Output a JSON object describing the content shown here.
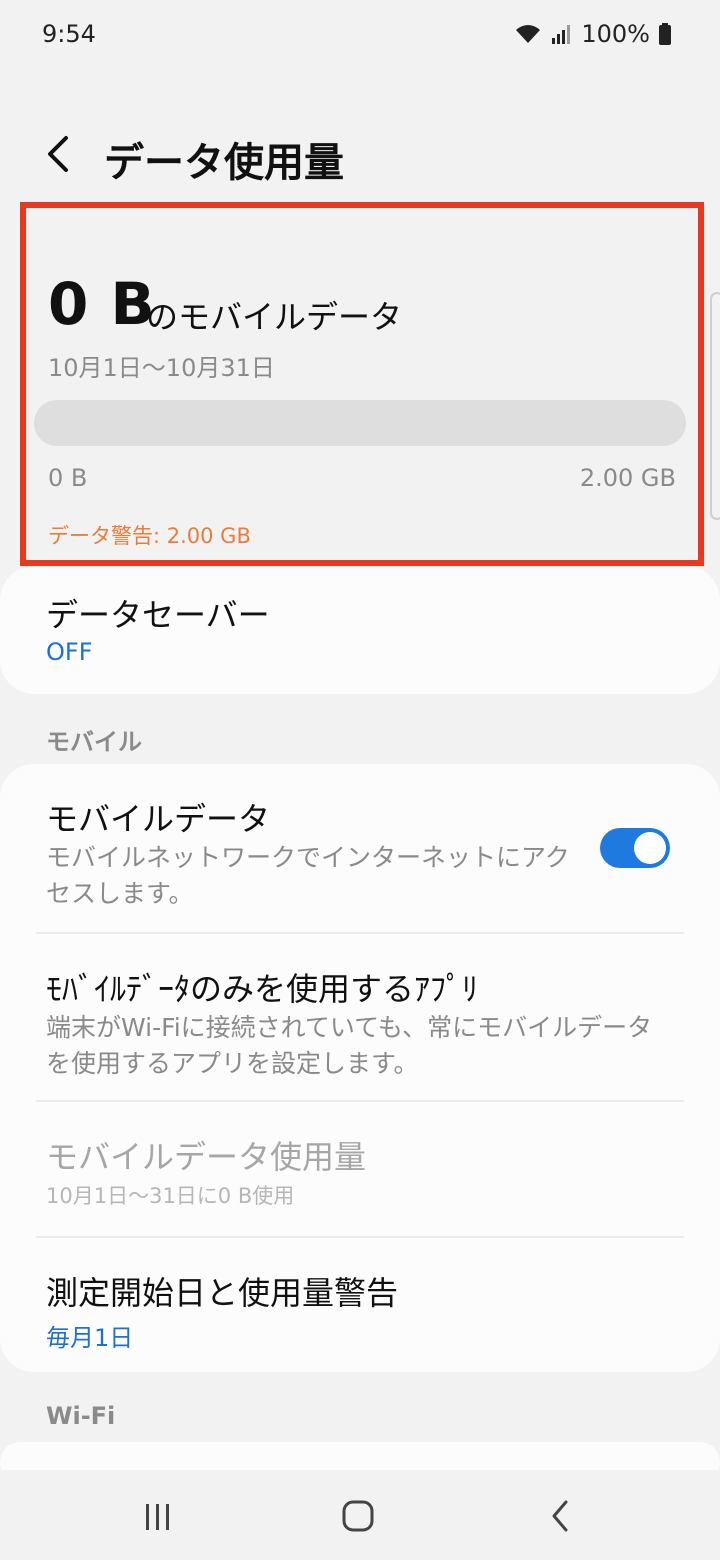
{
  "status": {
    "time": "9:54",
    "battery": "100%"
  },
  "header": {
    "title": "データ使用量"
  },
  "summary": {
    "amount": "0 B",
    "amount_suffix": "のモバイルデータ",
    "period": "10月1日〜10月31日",
    "usage_fraction": 0,
    "min_label": "0 B",
    "max_label": "2.00 GB",
    "warning": "データ警告: 2.00 GB"
  },
  "data_saver": {
    "title": "データセーバー",
    "value": "OFF"
  },
  "sections": {
    "mobile": "モバイル",
    "wifi": "Wi-Fi"
  },
  "mobile_items": [
    {
      "title": "モバイルデータ",
      "subtitle": "モバイルネットワークでインターネットにアクセスします。",
      "toggle": true
    },
    {
      "title": "ﾓﾊﾞｲﾙﾃﾞｰﾀのみを使用するｱﾌﾟﾘ",
      "subtitle": "端末がWi-Fiに接続されていても、常にモバイルデータを使用するアプリを設定します。"
    },
    {
      "title": "モバイルデータ使用量",
      "subtitle": "10月1日〜31日に0 B使用",
      "disabled": true
    },
    {
      "title": "測定開始日と使用量警告",
      "value": "毎月1日"
    }
  ],
  "colors": {
    "accent": "#1f7ae0",
    "highlight_border": "#e8391e",
    "warning": "#ef7b3a"
  }
}
